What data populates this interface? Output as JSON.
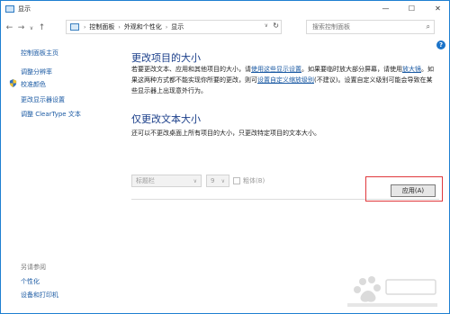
{
  "window": {
    "title": "显示",
    "controls": [
      "—",
      "☐",
      "✕"
    ]
  },
  "nav": {
    "back": "←",
    "forward": "→",
    "recent": "∨",
    "up": "↑",
    "breadcrumbs": [
      "控制面板",
      "外观和个性化",
      "显示"
    ],
    "refresh": "↻",
    "search_placeholder": "搜索控制面板"
  },
  "help_label": "?",
  "sidebar": {
    "home": "控制面板主页",
    "items": [
      "调整分辨率",
      "校准颜色",
      "更改显示器设置",
      "调整 ClearType 文本"
    ],
    "see_also_title": "另请参阅",
    "see_also": [
      "个性化",
      "设备和打印机"
    ]
  },
  "main": {
    "heading1": "更改项目的大小",
    "para1_part1": "若要更改文本、应用和其他项目的大小，请",
    "para1_link1": "使用这些显示设置",
    "para1_part2": "。如果要临时放大部分屏幕，请使用",
    "para1_link2": "放大镜",
    "para1_part3": "。如果这两种方式都不能实现你所要的更改，则可",
    "para1_link3": "设置自定义缩放级别",
    "para1_part4": "(不建议)。设置自定义级别可能会导致在某些显示器上出现意外行为。",
    "heading2": "仅更改文本大小",
    "para2": "还可以不更改桌面上所有项目的大小，只更改特定项目的文本大小。",
    "element_select": "标题栏",
    "size_select": "9",
    "bold_label": "粗体(B)",
    "apply_label": "应用(A)"
  },
  "watermark_text": "Baidu 经验"
}
